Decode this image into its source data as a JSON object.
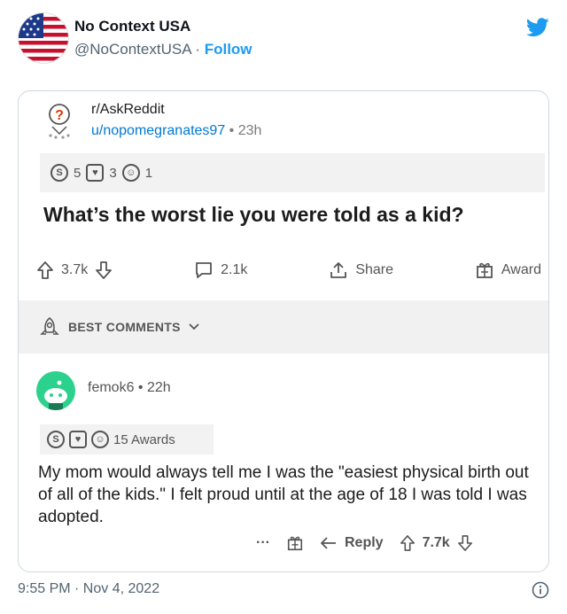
{
  "tweet": {
    "display_name": "No Context USA",
    "handle": "@NoContextUSA",
    "separator": " · ",
    "follow_label": "Follow",
    "timestamp": "9:55 PM · Nov 4, 2022"
  },
  "post": {
    "subreddit": "r/AskReddit",
    "author": "u/nopomegranates97",
    "meta_sep": " • ",
    "age": "23h",
    "awards": [
      {
        "icon": "silver-award-icon",
        "count": "5"
      },
      {
        "icon": "wholesome-award-icon",
        "count": "3"
      },
      {
        "icon": "helpful-award-icon",
        "count": "1"
      }
    ],
    "title": "What’s the worst lie you were told as a kid?",
    "upvotes": "3.7k",
    "comments": "2.1k",
    "share_label": "Share",
    "award_label": "Award"
  },
  "best_comments_label": "BEST COMMENTS",
  "comment": {
    "author": "femok6",
    "meta_sep": " • ",
    "age": "22h",
    "awards_label": "15 Awards",
    "text": "My mom would always tell me I was the \"easiest physical birth out of all of the kids.\" I felt proud until at the age of 18 I was told I was adopted.",
    "more_label": "···",
    "reply_label": "Reply",
    "votes": "7.7k"
  },
  "colors": {
    "twitter_blue": "#1d9bf0",
    "reddit_link": "#0079d3",
    "comment_avatar": "#2bd18c"
  }
}
